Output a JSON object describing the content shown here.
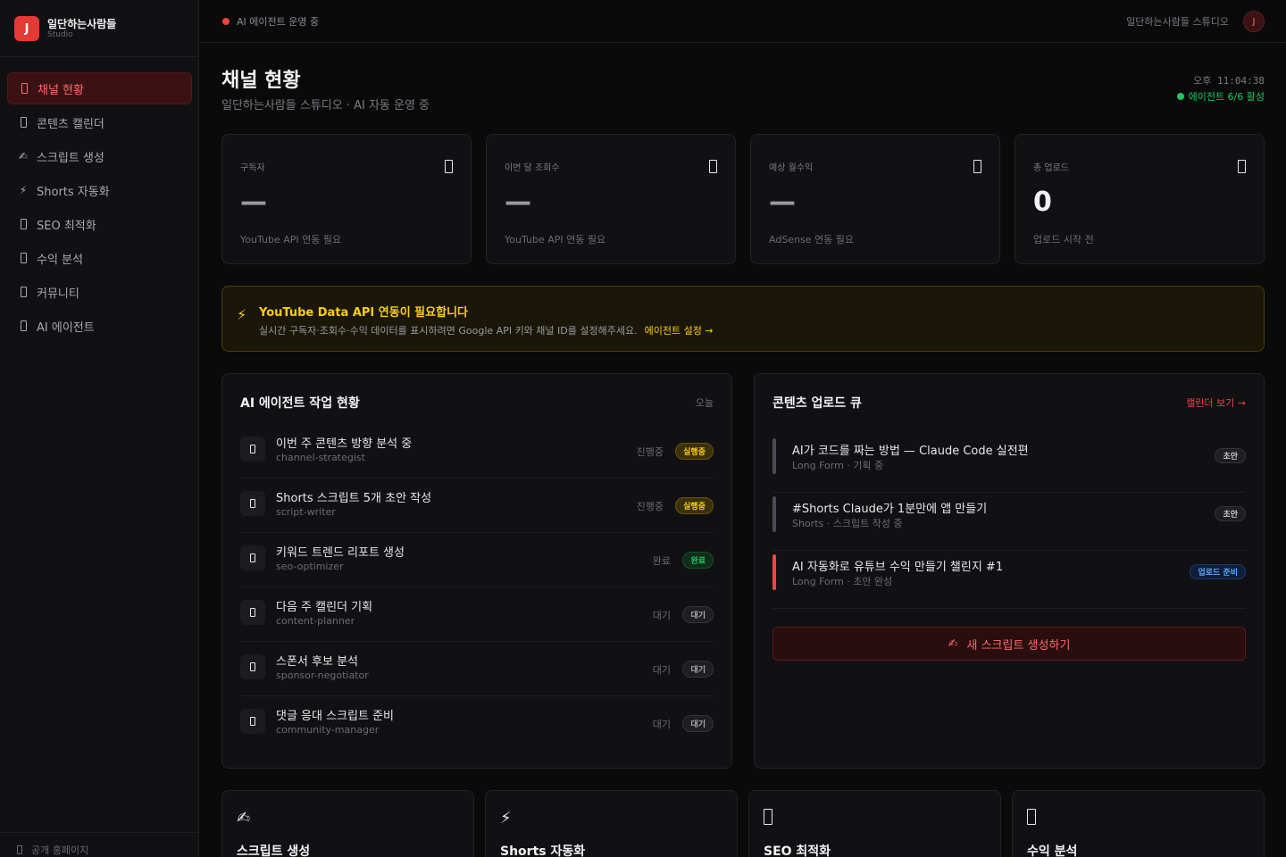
{
  "brand": {
    "logo_letter": "J",
    "name": "일단하는사람들",
    "sub": "Studio"
  },
  "sidebar": {
    "items": [
      {
        "label": "채널 현황",
        "icon": "box-icon",
        "active": true
      },
      {
        "label": "콘텐츠 캘린더",
        "icon": "box-icon"
      },
      {
        "label": "스크립트 생성",
        "icon": "writing-hand-icon"
      },
      {
        "label": "Shorts 자동화",
        "icon": "lightning-icon"
      },
      {
        "label": "SEO 최적화",
        "icon": "box-icon"
      },
      {
        "label": "수익 분석",
        "icon": "box-icon"
      },
      {
        "label": "커뮤니티",
        "icon": "box-icon"
      },
      {
        "label": "AI 에이전트",
        "icon": "box-icon"
      }
    ],
    "footer": "공개 홈페이지"
  },
  "topbar": {
    "status": "AI 에이전트 운영 중",
    "studio_name": "일단하는사람들 스튜디오",
    "avatar": "J"
  },
  "header": {
    "title": "채널 현황",
    "subtitle": "일단하는사람들 스튜디오 · AI 자동 운영 중",
    "time": "오후 11:04:38",
    "agents": "에이전트 6/6 활성"
  },
  "stats": [
    {
      "label": "구독자",
      "value": "—",
      "foot": "YouTube API 연동 필요"
    },
    {
      "label": "이번 달 조회수",
      "value": "—",
      "foot": "YouTube API 연동 필요"
    },
    {
      "label": "예상 월수익",
      "value": "—",
      "foot": "AdSense 연동 필요"
    },
    {
      "label": "총 업로드",
      "value": "0",
      "foot": "업로드 시작 전"
    }
  ],
  "alert": {
    "title": "YouTube Data API 연동이 필요합니다",
    "text": "실시간 구독자·조회수·수익 데이터를 표시하려면 Google API 키와 채널 ID를 설정해주세요.",
    "link": "에이전트 설정 →"
  },
  "tasks": {
    "title": "AI 에이전트 작업 현황",
    "meta": "오늘",
    "rows": [
      {
        "title": "이번 주 콘텐츠 방향 분석 중",
        "agent": "channel-strategist",
        "status": "진행중",
        "badge": "실행중"
      },
      {
        "title": "Shorts 스크립트 5개 초안 작성",
        "agent": "script-writer",
        "status": "진행중",
        "badge": "실행중"
      },
      {
        "title": "키워드 트렌드 리포트 생성",
        "agent": "seo-optimizer",
        "status": "완료",
        "badge": "완료"
      },
      {
        "title": "다음 주 캘린더 기획",
        "agent": "content-planner",
        "status": "대기",
        "badge": "대기"
      },
      {
        "title": "스폰서 후보 분석",
        "agent": "sponsor-negotiator",
        "status": "대기",
        "badge": "대기"
      },
      {
        "title": "댓글 응대 스크립트 준비",
        "agent": "community-manager",
        "status": "대기",
        "badge": "대기"
      }
    ]
  },
  "queue": {
    "title": "콘텐츠 업로드 큐",
    "link": "캘린더 보기 →",
    "rows": [
      {
        "title": "AI가 코드를 짜는 방법 — Claude Code 실전편",
        "meta": "Long Form · 기획 중",
        "badge": "초안"
      },
      {
        "title": "#Shorts Claude가 1분만에 앱 만들기",
        "meta": "Shorts · 스크립트 작성 중",
        "badge": "초안"
      },
      {
        "title": "AI 자동화로 유튜브 수익 만들기 챌린지 #1",
        "meta": "Long Form · 초안 완성",
        "badge": "업로드 준비"
      }
    ],
    "cta": "새 스크립트 생성하기"
  },
  "quick": [
    {
      "title": "스크립트 생성",
      "icon": "writing-hand-icon"
    },
    {
      "title": "Shorts 자동화",
      "icon": "lightning-icon"
    },
    {
      "title": "SEO 최적화",
      "icon": "box-icon"
    },
    {
      "title": "수익 분석",
      "icon": "box-icon"
    }
  ],
  "colors": {
    "accent": "#e53935",
    "warning": "#facc15",
    "success": "#22c55e",
    "info": "#60a5fa"
  }
}
